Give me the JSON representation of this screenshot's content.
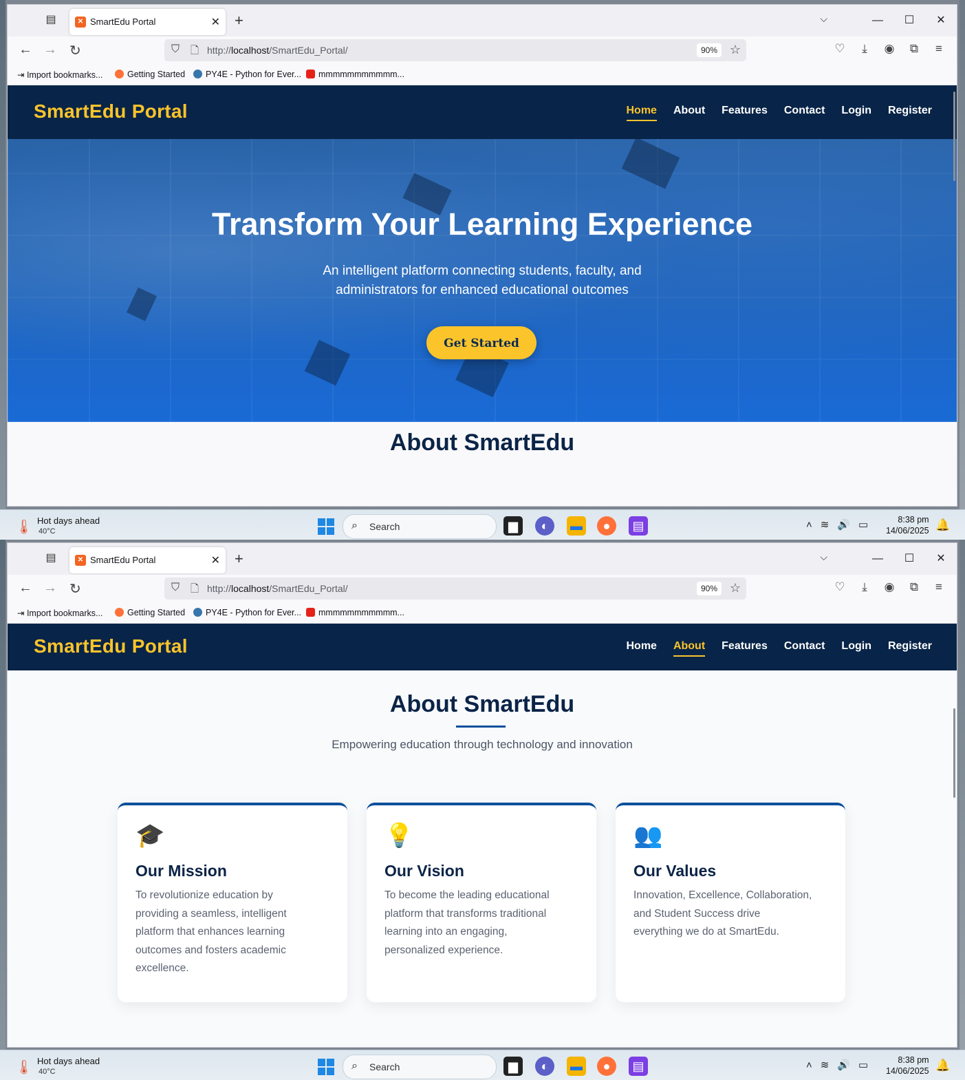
{
  "browser": {
    "tab_title": "SmartEdu Portal",
    "tab_favicon": "xampp-icon",
    "url_prefix": "http://",
    "url_host": "localhost",
    "url_path": "/SmartEdu_Portal/",
    "zoom": "90%",
    "bookmarks": [
      {
        "label": "Import bookmarks..."
      },
      {
        "label": "Getting Started"
      },
      {
        "label": "PY4E - Python for Ever..."
      },
      {
        "label": "mmmmmmmmmmm..."
      }
    ]
  },
  "site": {
    "logo": "SmartEdu Portal",
    "nav": [
      "Home",
      "About",
      "Features",
      "Contact",
      "Login",
      "Register"
    ],
    "hero": {
      "title": "Transform Your Learning Experience",
      "subtitle": "An intelligent platform connecting students, faculty, and administrators for enhanced educational outcomes",
      "cta": "Get Started"
    },
    "about": {
      "title": "About SmartEdu",
      "lead": "Empowering education through technology and innovation",
      "cards": [
        {
          "icon": "graduation-cap-icon",
          "title": "Our Mission",
          "text": "To revolutionize education by providing a seamless, intelligent platform that enhances learning outcomes and fosters academic excellence."
        },
        {
          "icon": "lightbulb-icon",
          "title": "Our Vision",
          "text": "To become the leading educational platform that transforms traditional learning into an engaging, personalized experience."
        },
        {
          "icon": "users-icon",
          "title": "Our Values",
          "text": "Innovation, Excellence, Collaboration, and Student Success drive everything we do at SmartEdu."
        }
      ]
    }
  },
  "taskbar": {
    "weather_title": "Hot days ahead",
    "weather_temp": "40°C",
    "search": "Search",
    "time": "8:38 pm",
    "date": "14/06/2025"
  },
  "colors": {
    "header_bg": "#082448",
    "accent": "#fbc42b",
    "primary": "#0b4f9c"
  }
}
